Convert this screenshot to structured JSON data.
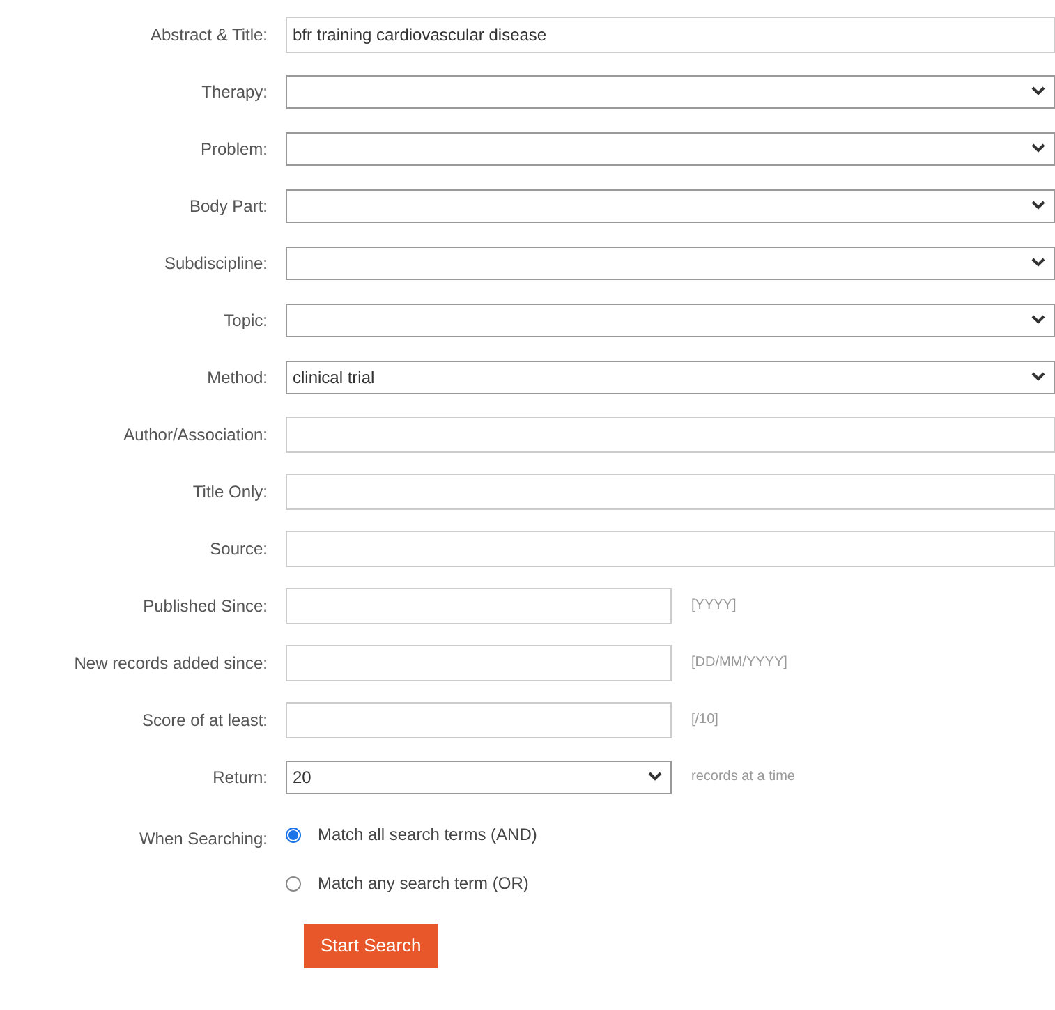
{
  "fields": [
    {
      "kind": "text",
      "label": "Abstract & Title:",
      "value": "bfr training cardiovascular disease"
    },
    {
      "kind": "select",
      "label": "Therapy:"
    },
    {
      "kind": "select",
      "label": "Problem:"
    },
    {
      "kind": "select",
      "label": "Body Part:"
    },
    {
      "kind": "select",
      "label": "Subdiscipline:"
    },
    {
      "kind": "select",
      "label": "Topic:"
    },
    {
      "kind": "select",
      "label": "Method:",
      "value": "clinical trial"
    },
    {
      "kind": "text",
      "label": "Author/Association:"
    },
    {
      "kind": "text",
      "label": "Title Only:"
    },
    {
      "kind": "text",
      "label": "Source:"
    },
    {
      "kind": "short",
      "label": "Published Since:",
      "note": "[YYYY]"
    },
    {
      "kind": "short",
      "label": "New records added since:",
      "note": "[DD/MM/YYYY]"
    },
    {
      "kind": "short",
      "label": "Score of at least:",
      "note": "[/10]"
    },
    {
      "kind": "shortselect",
      "label": "Return:",
      "value": "20",
      "note": "records at a time"
    }
  ],
  "searching": {
    "label": "When Searching:",
    "options": [
      {
        "label": "Match all search terms (AND)",
        "selected": true
      },
      {
        "label": "Match any search term (OR)",
        "selected": false
      }
    ]
  },
  "button": "Start Search"
}
